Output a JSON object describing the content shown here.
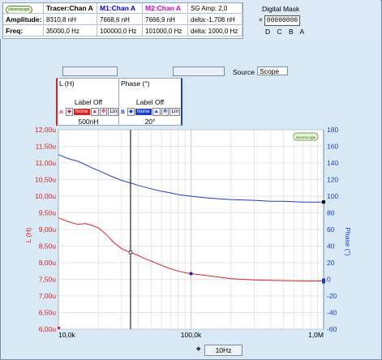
{
  "readout": {
    "logo": "cleverscope",
    "tracer_label": "Tracer:Chan A",
    "m1_label": "M1:Chan A",
    "m2_label": "M2:Chan A",
    "sg_label": "SG Amp: 2,0",
    "rows": [
      {
        "name": "Amplitude:",
        "tracer": "8310,8 nH",
        "m1": "7668,6 nH",
        "m2": "7666,9 nH",
        "sg": "delta:-1,708 nH"
      },
      {
        "name": "Freq:",
        "tracer": "35000,0 Hz",
        "m1": "100000,0 Hz",
        "m2": "101000,0 Hz",
        "sg": "delta: 1000,0 Hz"
      }
    ],
    "colors": {
      "m1": "#0000cc",
      "m2": "#cc00cc"
    }
  },
  "digital_mask": {
    "title": "Digital Mask",
    "value": "00000000",
    "x_mark": "×",
    "bits": "D C B A"
  },
  "source": {
    "label": "Source",
    "value": "Scope"
  },
  "panel_a": {
    "title": "L (H)",
    "label_off": "Label Off",
    "channel": "A",
    "none": "None",
    "lin": "Lin",
    "value": "500nH",
    "color": "#e02020"
  },
  "panel_b": {
    "title": "Phase (°)",
    "label_off": "Label Off",
    "channel": "B",
    "none": "None",
    "lin": "Lin",
    "value": "20°",
    "color": "#1a3fd0"
  },
  "chart_data": {
    "type": "line",
    "xscale": "log",
    "xlim": [
      10000,
      1000000
    ],
    "x_ticks": [
      "10,0k",
      "100,0k",
      "1,0M"
    ],
    "y_left": {
      "label": "L (H)",
      "ticks": [
        "12,00u",
        "11,50u",
        "11,00u",
        "10,50u",
        "10,00u",
        "9,50u",
        "9,00u",
        "8,50u",
        "8,00u",
        "7,50u",
        "7,00u",
        "6,50u",
        "6,00u"
      ],
      "lim": [
        6.0,
        12.0
      ],
      "unit": "uH",
      "color": "#e02020"
    },
    "y_right": {
      "label": "Phase (°)",
      "ticks": [
        "180",
        "160",
        "140",
        "120",
        "100",
        "80",
        "60",
        "40",
        "20",
        "0",
        "-20",
        "-40",
        "-60"
      ],
      "lim": [
        -60,
        180
      ],
      "color": "#1a3fd0"
    },
    "series": [
      {
        "axis": "left",
        "color": "#e02020",
        "x": [
          10000,
          12000,
          14000,
          16000,
          18000,
          20000,
          23000,
          26000,
          30000,
          35000,
          40000,
          45000,
          50000,
          60000,
          70000,
          80000,
          90000,
          100000,
          130000,
          160000,
          200000,
          300000,
          400000,
          500000,
          700000,
          1000000
        ],
        "y": [
          9.35,
          9.23,
          9.15,
          9.18,
          9.12,
          9.05,
          8.85,
          8.62,
          8.42,
          8.31,
          8.22,
          8.12,
          8.05,
          7.92,
          7.82,
          7.75,
          7.7,
          7.67,
          7.62,
          7.57,
          7.52,
          7.48,
          7.47,
          7.46,
          7.45,
          7.45
        ]
      },
      {
        "axis": "right",
        "color": "#1a3fd0",
        "x": [
          10000,
          12000,
          14000,
          16000,
          18000,
          20000,
          25000,
          30000,
          35000,
          40000,
          50000,
          60000,
          70000,
          80000,
          100000,
          130000,
          160000,
          200000,
          300000,
          400000,
          500000,
          700000,
          1000000
        ],
        "y": [
          150,
          145,
          142,
          138,
          134,
          131,
          124,
          119,
          116,
          113,
          109,
          106,
          104,
          102,
          100,
          98,
          97,
          96,
          95,
          94,
          94,
          93,
          93
        ]
      }
    ],
    "tracer_x": 35000,
    "m1_x": 100000
  },
  "bottom": {
    "freq_value": "10Hz",
    "spinner": "◆"
  }
}
